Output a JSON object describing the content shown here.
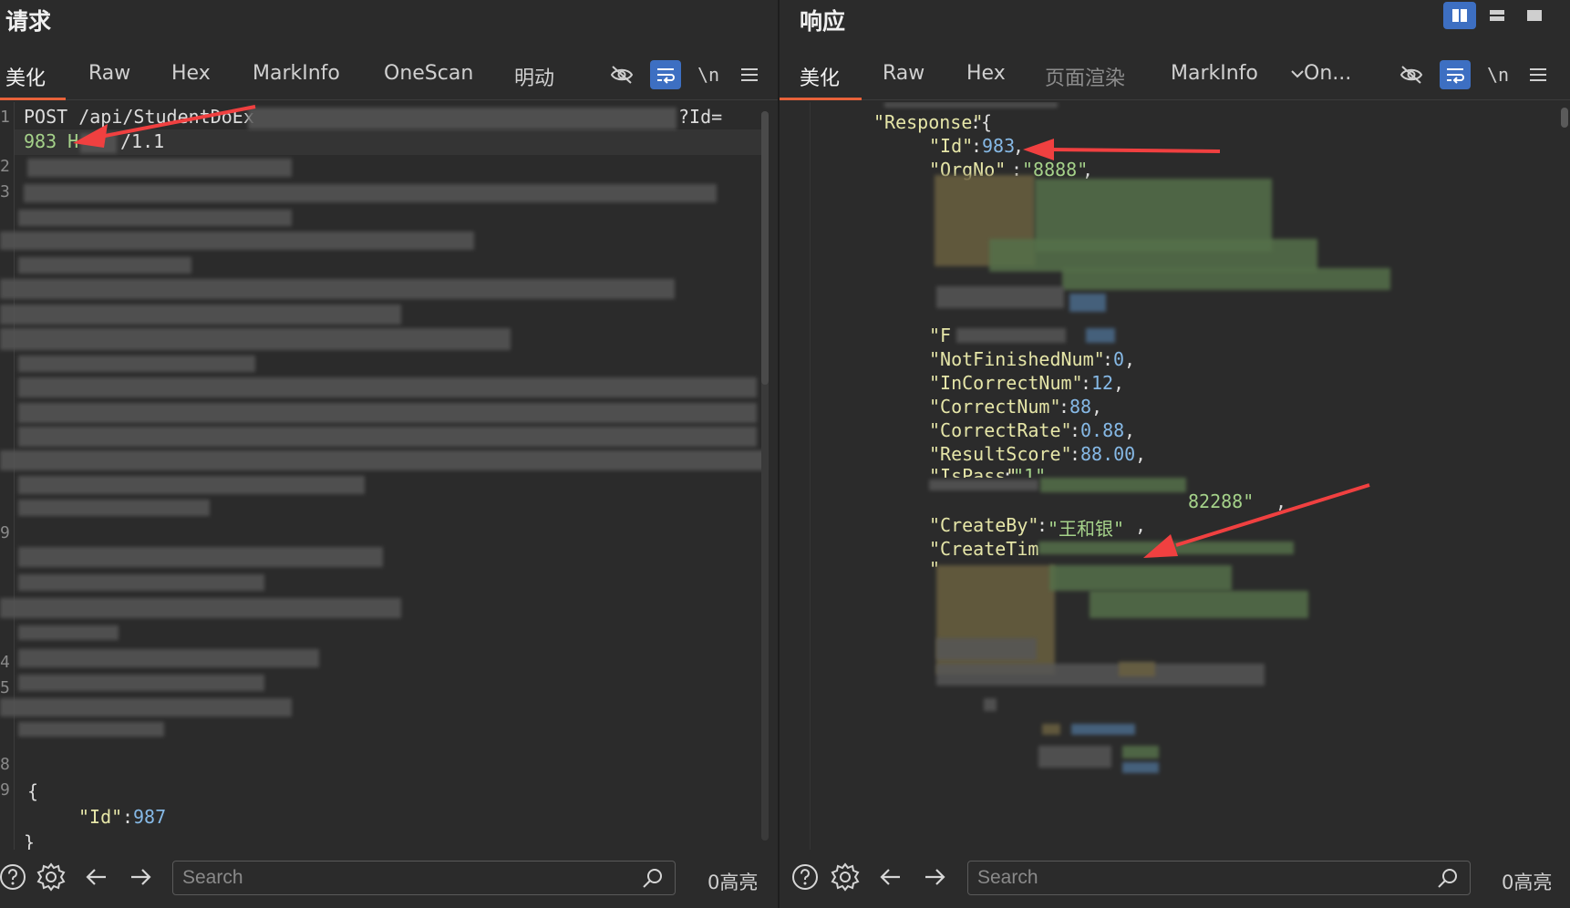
{
  "request": {
    "title": "请求",
    "tabs": [
      "美化",
      "Raw",
      "Hex",
      "MarkInfo",
      "OneScan",
      "明动"
    ],
    "tools": {
      "wrap": "\\n"
    },
    "lines": {
      "l1a": "POST /api/StudentDoEx",
      "l1b": "?Id=",
      "l1c": "983 H",
      "l1d": "/1.1",
      "body_open": "{",
      "body_key": "\"Id\"",
      "body_colon": ":",
      "body_val": "987",
      "body_close": "}"
    },
    "line_numbers": [
      "1",
      "2",
      "3",
      "9",
      "4",
      "5",
      "8",
      "9"
    ],
    "search_placeholder": "Search",
    "highlight_count": "0高亮"
  },
  "response": {
    "title": "响应",
    "tabs": [
      "美化",
      "Raw",
      "Hex",
      "页面渲染",
      "MarkInfo",
      "On..."
    ],
    "tools": {
      "wrap": "\\n"
    },
    "lines": {
      "response_key": "\"Response\"",
      "response_open": ":{",
      "id_key": "\"Id\"",
      "id_val": "983",
      "orgno_key": "\"OrgNo\"",
      "orgno_val": "\"8888\"",
      "f_key": "\"F",
      "notfinished_key": "\"NotFinishedNum\"",
      "notfinished_val": "0",
      "incorrect_key": "\"InCorrectNum\"",
      "incorrect_val": "12",
      "correct_key": "\"CorrectNum\"",
      "correct_val": "88",
      "rate_key": "\"CorrectRate\"",
      "rate_val": "0.88",
      "score_key": "\"ResultScore\"",
      "score_val": "88.00",
      "ispass_key": "\"IsPass\"",
      "ispass_val": "\"1\"",
      "tail_val": "82288\"",
      "createby_key": "\"CreateBy\"",
      "createby_val": "\"王和银\"",
      "createtime_key": "\"CreateTim",
      "quote": "\""
    },
    "search_placeholder": "Search",
    "highlight_count": "0高亮"
  },
  "colors": {
    "accent": "#e8623a",
    "toggle_on": "#3d6fc2",
    "arrow": "#f04040"
  }
}
